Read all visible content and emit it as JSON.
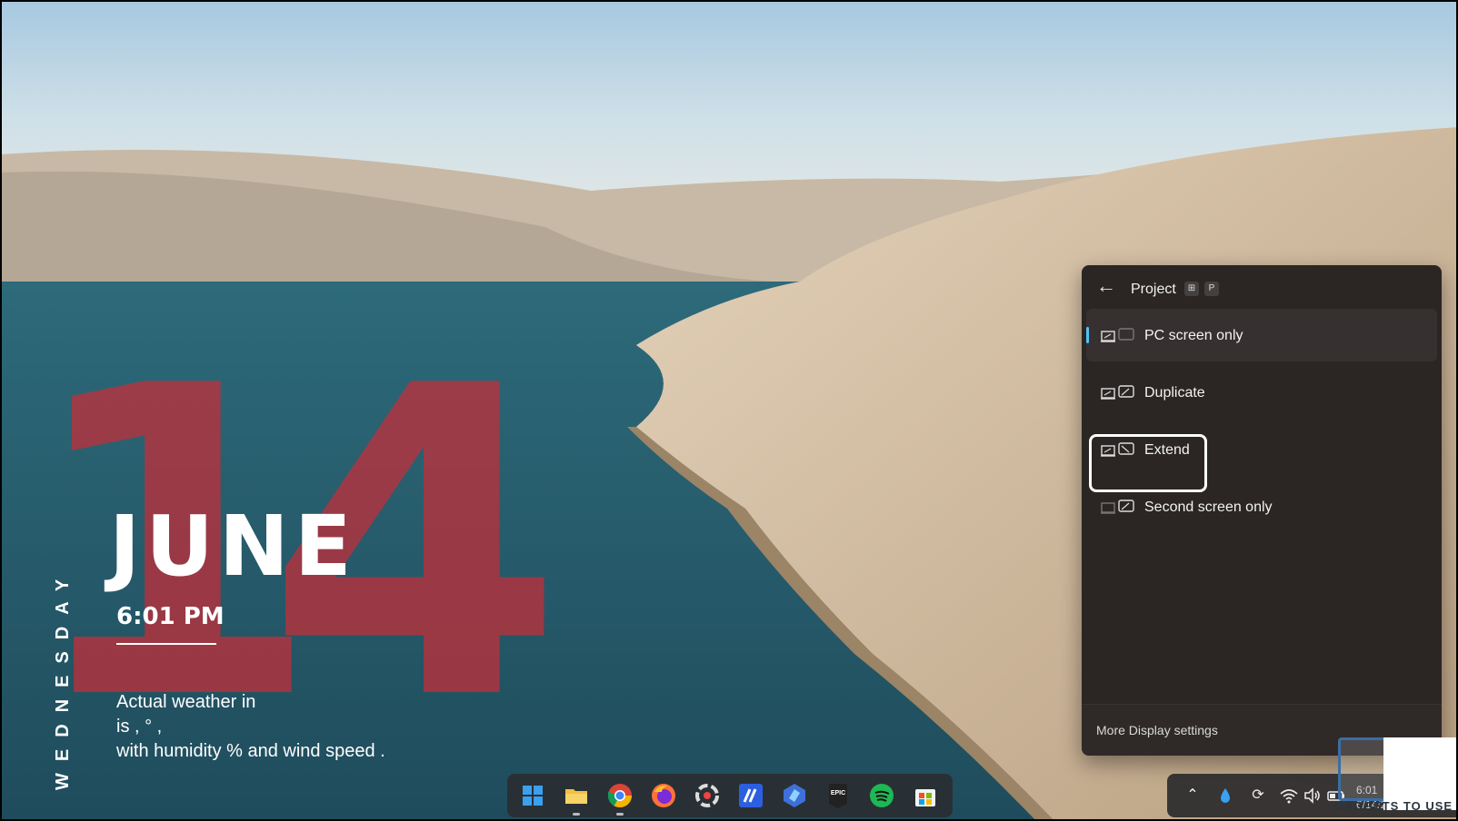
{
  "widget": {
    "day_number": "14",
    "month": "JUNE",
    "time": "6:01 PM",
    "weekday": "WEDNESDAY",
    "weather_line1": "Actual weather in",
    "weather_line2": "is , ° ,",
    "weather_line3": "with humidity  % and wind speed  ."
  },
  "project_panel": {
    "title": "Project",
    "shortcut_keys": [
      "⊞",
      "P"
    ],
    "options": [
      {
        "label": "PC screen only",
        "icon": "pc-screen-only-icon",
        "selected": true
      },
      {
        "label": "Duplicate",
        "icon": "duplicate-icon",
        "selected": false
      },
      {
        "label": "Extend",
        "icon": "extend-icon",
        "selected": false,
        "focused": true
      },
      {
        "label": "Second screen only",
        "icon": "second-screen-only-icon",
        "selected": false
      }
    ],
    "footer_link": "More Display settings"
  },
  "taskbar": {
    "apps": [
      "start-icon",
      "file-explorer-icon",
      "chrome-icon",
      "firefox-icon",
      "davinci-icon",
      "vs-code-icon",
      "bing-icon",
      "epic-games-icon",
      "spotify-icon",
      "microsoft-store-icon"
    ]
  },
  "tray": {
    "time": "6:01",
    "date": "6/14/2"
  },
  "colors": {
    "panel_bg": "#2b2624",
    "accent": "#4fc3f7",
    "date_red": "#c82d37"
  },
  "watermark": "GADGETS TO USE"
}
